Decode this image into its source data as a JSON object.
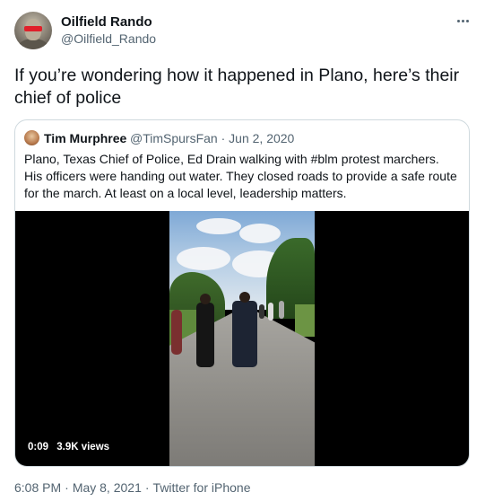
{
  "author": {
    "display_name": "Oilfield Rando",
    "handle": "@Oilfield_Rando"
  },
  "tweet": {
    "text": "If you’re wondering how it happened in Plano, here’s their chief of police"
  },
  "quoted_tweet": {
    "display_name": "Tim Murphree",
    "handle": "@TimSpursFan",
    "separator": "·",
    "date": "Jun 2, 2020",
    "text": "Plano, Texas Chief of Police, Ed Drain walking with #blm protest marchers. His officers were handing out water. They closed roads to provide a safe route for the march. At least on a local level, leadership matters.",
    "video": {
      "duration": "0:09",
      "views": "3.9K views"
    }
  },
  "footer": {
    "time": "6:08 PM",
    "separator": "·",
    "date": "May 8, 2021",
    "source": "Twitter for iPhone"
  },
  "icons": {
    "more": "more-horizontal-icon"
  },
  "colors": {
    "text_primary": "#0f1419",
    "text_secondary": "#536471",
    "border": "#cfd9de",
    "video_bg": "#000000"
  }
}
